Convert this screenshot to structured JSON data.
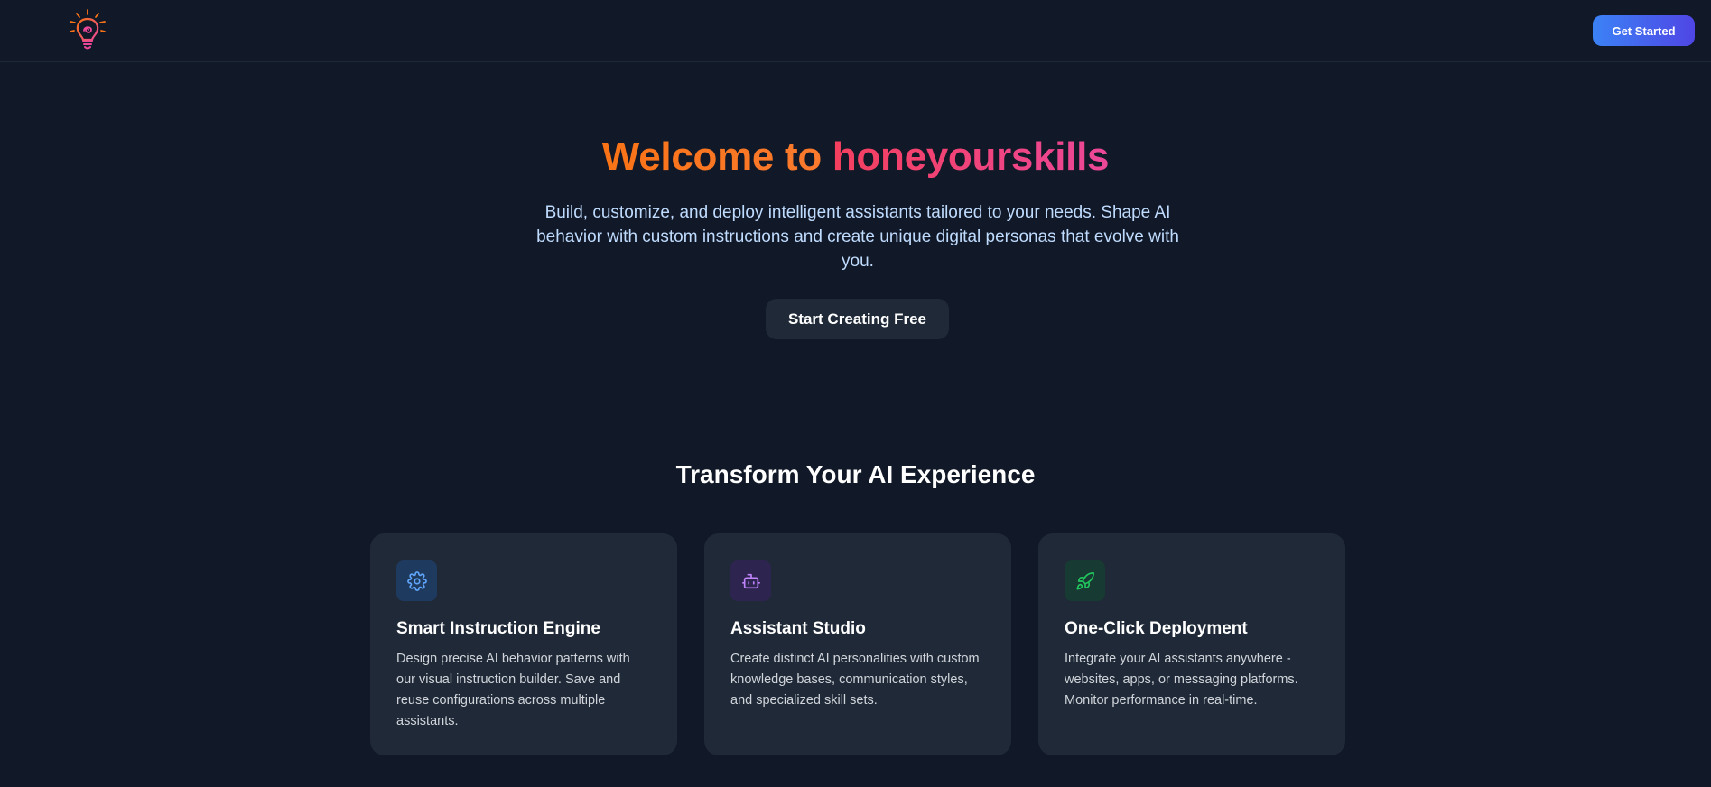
{
  "nav": {
    "get_started_label": "Get Started"
  },
  "hero": {
    "title_part1": "Welcome to ",
    "title_part2": "honeyourskills",
    "subtitle": "Build, customize, and deploy intelligent assistants tailored to your needs. Shape AI behavior with custom instructions and create unique digital personas that evolve with you.",
    "cta_label": "Start Creating Free"
  },
  "features": {
    "title": "Transform Your AI Experience",
    "cards": [
      {
        "icon": "gear-icon",
        "title": "Smart Instruction Engine",
        "description": "Design precise AI behavior patterns with our visual instruction builder. Save and reuse configurations across multiple assistants."
      },
      {
        "icon": "robot-icon",
        "title": "Assistant Studio",
        "description": "Create distinct AI personalities with custom knowledge bases, communication styles, and specialized skill sets."
      },
      {
        "icon": "rocket-icon",
        "title": "One-Click Deployment",
        "description": "Integrate your AI assistants anywhere - websites, apps, or messaging platforms. Monitor performance in real-time."
      }
    ]
  },
  "colors": {
    "background": "#111827",
    "card": "#1f2937",
    "accent_orange": "#f97316",
    "accent_pink": "#f43f5e",
    "button_blue": "#3b82f6"
  }
}
